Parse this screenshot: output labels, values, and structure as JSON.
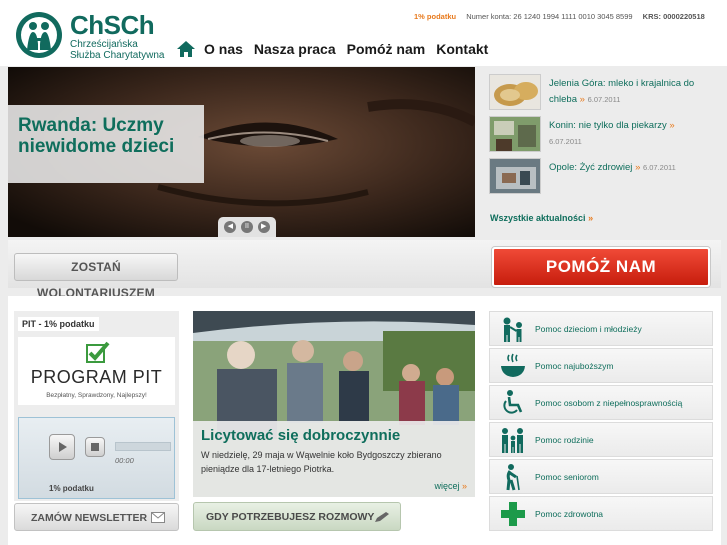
{
  "brand": {
    "short_name": "ChSCh",
    "full_name_line1": "Chrześcijańska",
    "full_name_line2": "Służba Charytatywna",
    "color": "#116a5e"
  },
  "top_info": {
    "pit_link": "1% podatku",
    "account": "Numer konta: 26 1240 1994 1111 0010 3045 8599",
    "krs": "KRS: 0000220518"
  },
  "nav": {
    "home_icon": "home-icon",
    "items": [
      "O nas",
      "Nasza praca",
      "Pomóż nam",
      "Kontakt"
    ]
  },
  "hero": {
    "caption": "Rwanda: Uczmy niewidome dzieci",
    "controls": {
      "prev": "◀",
      "pause": "II",
      "next": "▶"
    }
  },
  "news": {
    "items": [
      {
        "title": "Jelenia Góra: mleko i krajalnica do chleba",
        "arrow": "»",
        "date": "6.07.2011"
      },
      {
        "title": "Konin: nie tylko dla piekarzy",
        "arrow": "»",
        "date": "6.07.2011"
      },
      {
        "title": "Opole: Żyć zdrowiej",
        "arrow": "»",
        "date": "6.07.2011"
      }
    ],
    "all_link": "Wszystkie aktualności",
    "all_arrow": "»"
  },
  "buttons": {
    "volunteer": "ZOSTAŃ WOLONTARIUSZEM",
    "help": "POMÓŻ NAM",
    "newsletter": "ZAMÓW NEWSLETTER",
    "talk": "GDY POTRZEBUJESZ ROZMOWY"
  },
  "pit": {
    "title": "PIT - 1% podatku",
    "program": "PROGRAM PIT",
    "slogan": "Bezpłatny, Sprawdzony, Najlepszy!",
    "player_time": "00:00",
    "player_label": "1% podatku"
  },
  "feature": {
    "title": "Licytować się dobroczynnie",
    "text": "W niedzielę, 29 maja w Wąwelnie koło Bydgoszczy zbierano pieniądze dla 17-letniego Piotrka.",
    "more": "więcej",
    "more_arrow": "»"
  },
  "help_areas": [
    {
      "label": "Pomoc dzieciom i młodzieży",
      "icon": "children-icon"
    },
    {
      "label": "Pomoc najuboższym",
      "icon": "soup-bowl-icon"
    },
    {
      "label": "Pomoc osobom z niepełnosprawnością",
      "icon": "wheelchair-icon"
    },
    {
      "label": "Pomoc rodzinie",
      "icon": "family-icon"
    },
    {
      "label": "Pomoc seniorom",
      "icon": "senior-icon"
    },
    {
      "label": "Pomoc zdrowotna",
      "icon": "medical-cross-icon"
    }
  ],
  "colors": {
    "accent": "#0f6e5c",
    "orange": "#e87a1d",
    "help_red": "#e0321f"
  }
}
